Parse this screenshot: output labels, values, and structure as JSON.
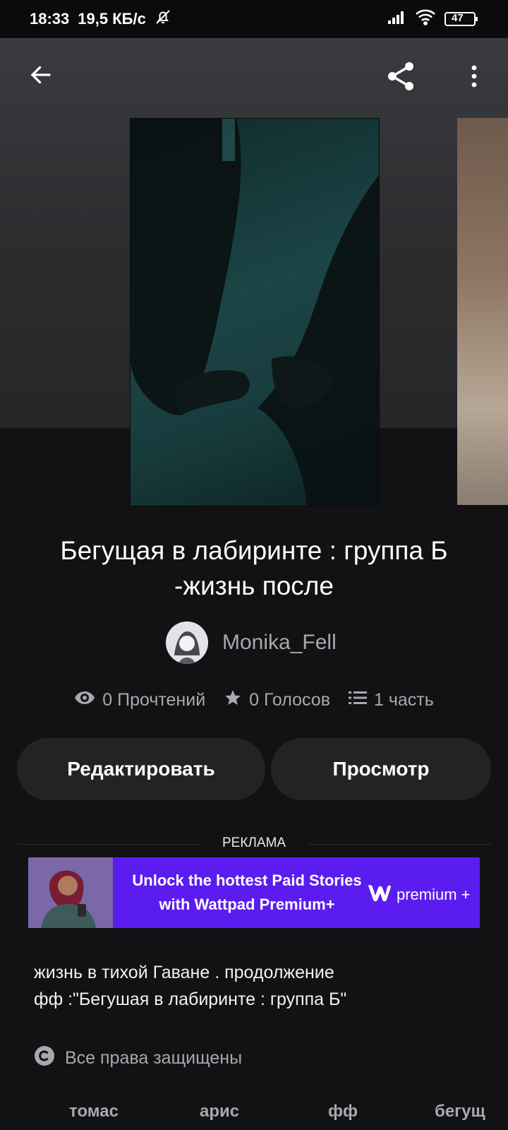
{
  "status_bar": {
    "time": "18:33",
    "speed": "19,5 КБ/с",
    "battery": "47",
    "icons": [
      "bell-off-icon",
      "signal-icon",
      "wifi-icon",
      "battery-icon"
    ]
  },
  "toolbar": {
    "back_icon": "arrow-left-icon",
    "share_icon": "share-icon",
    "more_icon": "more-vertical-icon"
  },
  "story": {
    "title": "Бегущая в лабиринте : группа Б -жизнь после",
    "author": "Monika_Fell",
    "stats": {
      "reads": "0 Прочтений",
      "votes": "0 Голосов",
      "parts": "1 часть"
    },
    "description_line1": "жизнь в тихой Гаване . продолжение",
    "description_line2": "фф :\"Бегушая в лабиринте : группа Б\"",
    "rights": "Все права защищены"
  },
  "actions": {
    "edit_label": "Редактировать",
    "preview_label": "Просмотр"
  },
  "ad": {
    "label": "РЕКЛАМА",
    "line1": "Unlock the hottest Paid Stories",
    "line2": "with Wattpad Premium+",
    "logo_text": "premium +",
    "bg_color": "#5b1cf0"
  },
  "tags": [
    "томас",
    "арис",
    "фф",
    "бегущ"
  ],
  "colors": {
    "background": "#121114",
    "button": "#232225",
    "muted_text": "#a9a8ad"
  }
}
